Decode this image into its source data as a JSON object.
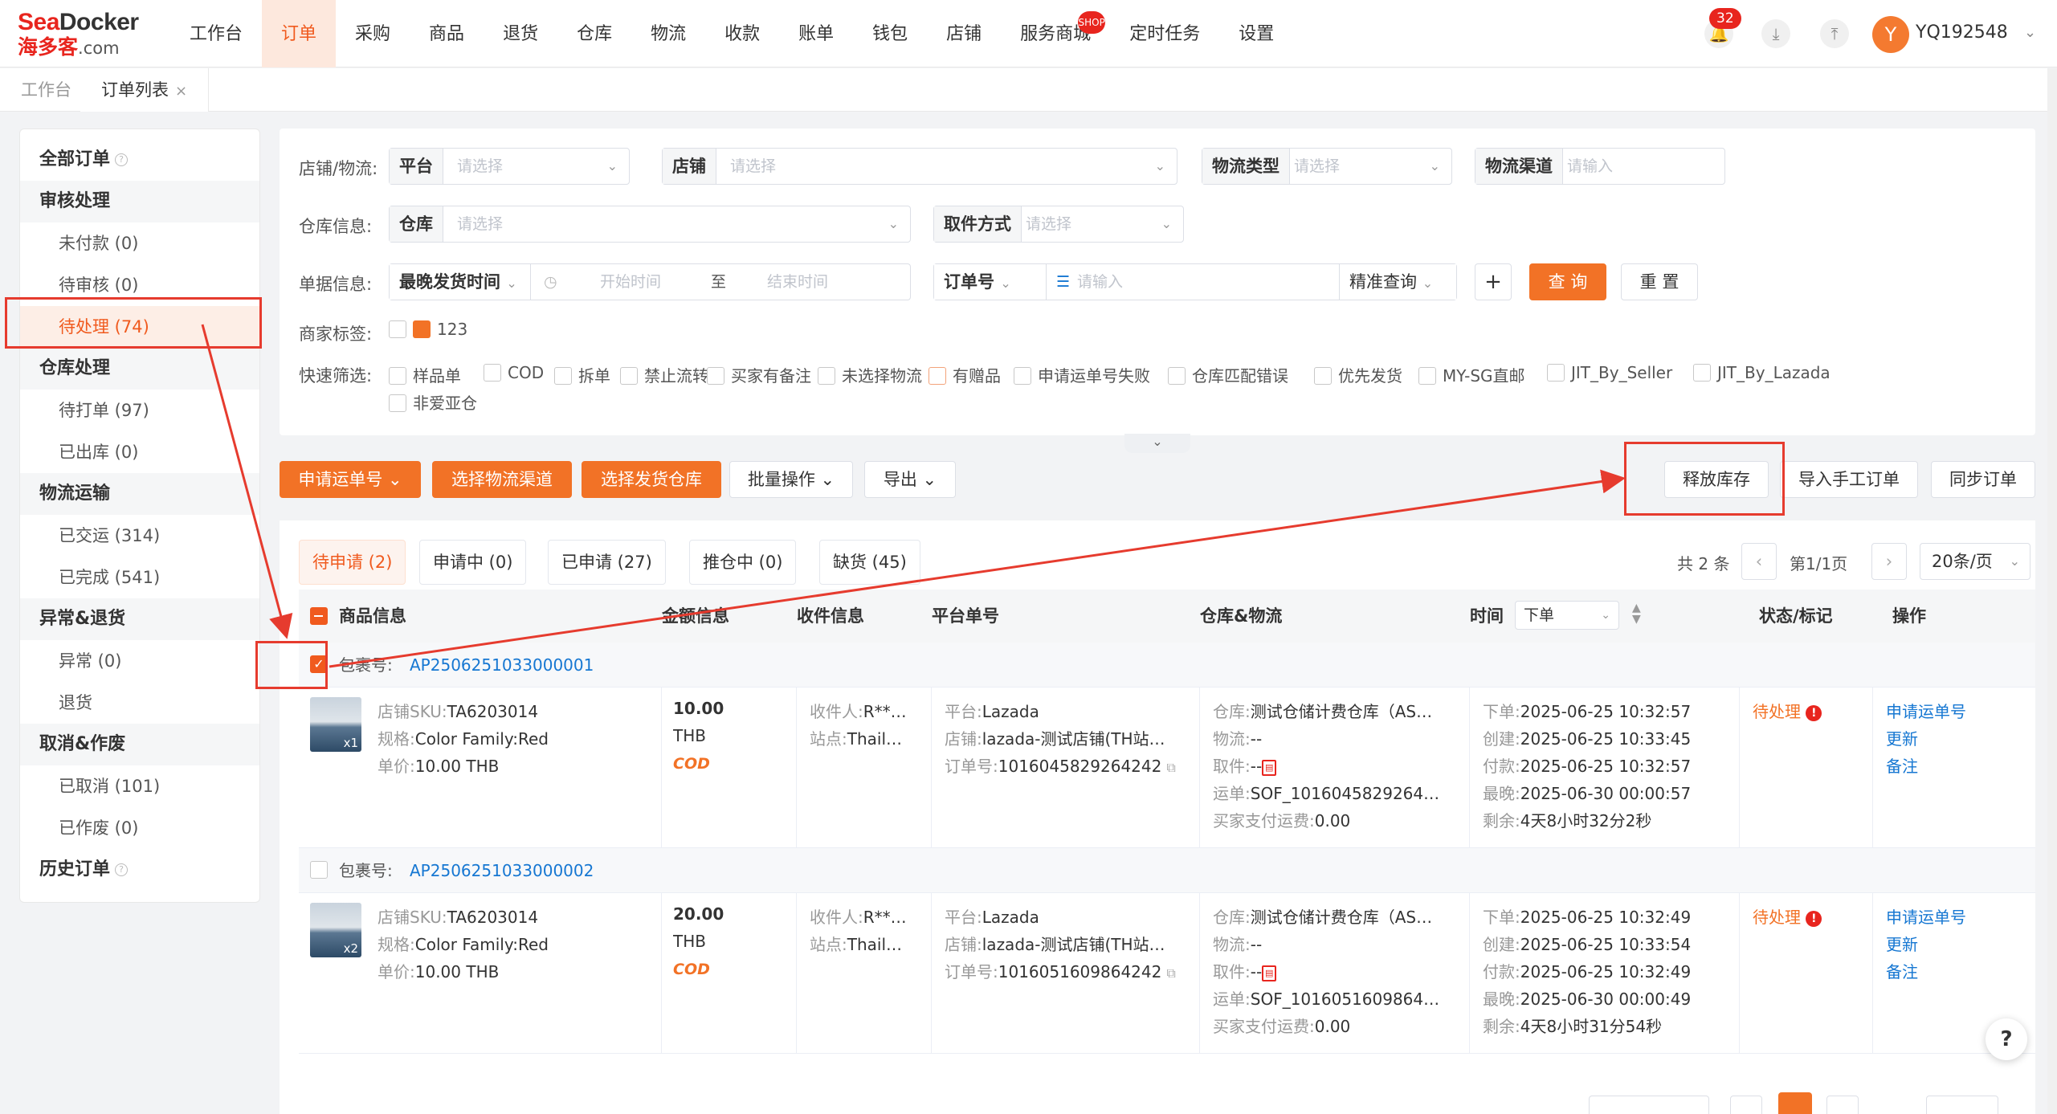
{
  "brand": {
    "line1a": "Sea",
    "line1b": "Docker",
    "line2": "海多客",
    "line2b": ".com",
    "color": "#e8251e"
  },
  "nav": {
    "items": [
      "工作台",
      "订单",
      "采购",
      "商品",
      "退货",
      "仓库",
      "物流",
      "收款",
      "账单",
      "钱包",
      "店铺",
      "服务商城",
      "定时任务",
      "设置"
    ],
    "active_index": 1,
    "service_badge": "SHOP"
  },
  "topright": {
    "message_count": "32",
    "username": "YQ192548",
    "avatar_initial": "Y"
  },
  "tabs": {
    "workbench": "工作台",
    "order_list": "订单列表",
    "close": "×"
  },
  "sidebar": {
    "all_orders": "全部订单",
    "groups": [
      {
        "title": "审核处理",
        "items": [
          "未付款 (0)",
          "待审核 (0)",
          "待处理 (74)"
        ]
      },
      {
        "title": "仓库处理",
        "items": [
          "待打单 (97)",
          "已出库 (0)"
        ]
      },
      {
        "title": "物流运输",
        "items": [
          "已交运 (314)",
          "已完成 (541)"
        ]
      },
      {
        "title": "异常&退货",
        "items": [
          "异常 (0)",
          "退货"
        ]
      },
      {
        "title": "取消&作废",
        "items": [
          "已取消 (101)",
          "已作废 (0)"
        ]
      }
    ],
    "history": "历史订单",
    "active_item": "待处理 (74)"
  },
  "filters": {
    "row1_label": "店铺/物流:",
    "platform_key": "平台",
    "platform_ph": "请选择",
    "shop_key": "店铺",
    "shop_ph": "请选择",
    "logistics_type_key": "物流类型",
    "logistics_type_ph": "请选择",
    "logistics_channel_key": "物流渠道",
    "logistics_channel_ph": "请输入",
    "row2_label": "仓库信息:",
    "warehouse_key": "仓库",
    "warehouse_ph": "请选择",
    "pickup_key": "取件方式",
    "pickup_ph": "请选择",
    "row3_label": "单据信息:",
    "date_key": "最晚发货时间",
    "start_ph": "开始时间",
    "to": "至",
    "end_ph": "结束时间",
    "order_no_key": "订单号",
    "order_no_ph": "请输入",
    "match_mode": "精准查询",
    "add_btn": "+",
    "search_btn": "查 询",
    "reset_btn": "重 置",
    "row4_label": "商家标签:",
    "tag_label": "123",
    "row5_label": "快速筛选:",
    "quick": [
      "样品单",
      "COD",
      "拆单",
      "禁止流转",
      "买家有备注",
      "未选择物流",
      "有赠品",
      "申请运单号失败",
      "仓库匹配错误",
      "优先发货",
      "MY-SG直邮",
      "JIT_By_Seller",
      "JIT_By_Lazada",
      "非爱亚仓"
    ]
  },
  "actions": {
    "apply_waybill": "申请运单号",
    "select_channel": "选择物流渠道",
    "select_warehouse": "选择发货仓库",
    "batch": "批量操作",
    "export": "导出",
    "release_stock": "释放库存",
    "import_manual": "导入手工订单",
    "sync": "同步订单"
  },
  "status_tabs": [
    "待申请 (2)",
    "申请中 (0)",
    "已申请 (27)",
    "推仓中 (0)",
    "缺货 (45)"
  ],
  "pager": {
    "total": "共 2 条",
    "page": "第1/1页",
    "size": "20条/页"
  },
  "columns": [
    "商品信息",
    "金额信息",
    "收件信息",
    "平台单号",
    "仓库&物流",
    "时间",
    "状态/标记",
    "操作"
  ],
  "time_sort": "下单",
  "orders": [
    {
      "pkg_label": "包裹号:",
      "pkg_no": "AP2506251033000001",
      "checked": true,
      "sku_label": "店铺SKU:",
      "sku": "TA6203014",
      "spec_label": "规格:",
      "spec": "Color Family:Red",
      "price_label": "单价:",
      "price": "10.00 THB",
      "qty": "x1",
      "amount": "10.00",
      "currency": "THB",
      "cod": "COD",
      "recv_label": "收件人:",
      "recv": "R**…",
      "site_label": "站点:",
      "site": "Thail…",
      "plat_label": "平台:",
      "platform": "Lazada",
      "shop_label": "店铺:",
      "shop": "lazada-测试店铺(TH站…",
      "ono_label": "订单号:",
      "order_no": "1016045829264242",
      "wh_label": "仓库:",
      "warehouse": "测试仓储计费仓库（AS…",
      "lg_label": "物流:",
      "logistics": "--",
      "pk_label": "取件:",
      "pickup": "--",
      "wb_label": "运单:",
      "waybill": "SOF_1016045829264…",
      "fee_label": "买家支付运费:",
      "fee": "0.00",
      "t1_label": "下单:",
      "t1": "2025-06-25 10:32:57",
      "t2_label": "创建:",
      "t2": "2025-06-25 10:33:45",
      "t3_label": "付款:",
      "t3": "2025-06-25 10:32:57",
      "t4_label": "最晚:",
      "t4": "2025-06-30 00:00:57",
      "t5_label": "剩余:",
      "t5": "4天8小时32分2秒",
      "status": "待处理",
      "ops": [
        "申请运单号",
        "更新",
        "备注"
      ]
    },
    {
      "pkg_label": "包裹号:",
      "pkg_no": "AP2506251033000002",
      "checked": false,
      "sku_label": "店铺SKU:",
      "sku": "TA6203014",
      "spec_label": "规格:",
      "spec": "Color Family:Red",
      "price_label": "单价:",
      "price": "10.00 THB",
      "qty": "x2",
      "amount": "20.00",
      "currency": "THB",
      "cod": "COD",
      "recv_label": "收件人:",
      "recv": "R**…",
      "site_label": "站点:",
      "site": "Thail…",
      "plat_label": "平台:",
      "platform": "Lazada",
      "shop_label": "店铺:",
      "shop": "lazada-测试店铺(TH站…",
      "ono_label": "订单号:",
      "order_no": "1016051609864242",
      "wh_label": "仓库:",
      "warehouse": "测试仓储计费仓库（AS…",
      "lg_label": "物流:",
      "logistics": "--",
      "pk_label": "取件:",
      "pickup": "--",
      "wb_label": "运单:",
      "waybill": "SOF_1016051609864…",
      "fee_label": "买家支付运费:",
      "fee": "0.00",
      "t1_label": "下单:",
      "t1": "2025-06-25 10:32:49",
      "t2_label": "创建:",
      "t2": "2025-06-25 10:33:54",
      "t3_label": "付款:",
      "t3": "2025-06-25 10:32:49",
      "t4_label": "最晚:",
      "t4": "2025-06-30 00:00:49",
      "t5_label": "剩余:",
      "t5": "4天8小时31分54秒",
      "status": "待处理",
      "ops": [
        "申请运单号",
        "更新",
        "备注"
      ]
    }
  ],
  "help": "?",
  "colors": {
    "accent": "#f27226",
    "active_text": "#f05a1e",
    "link": "#1677d2",
    "annotation": "#e63b2e"
  }
}
